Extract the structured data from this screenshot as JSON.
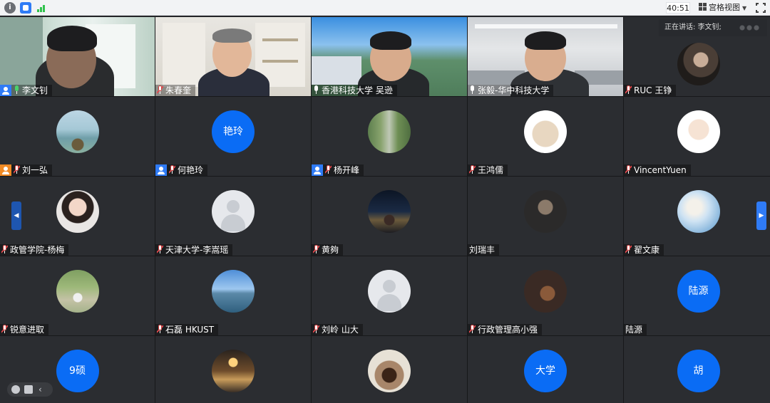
{
  "topbar": {
    "timer": "40:51",
    "layout_label": "宫格视图"
  },
  "speaking": {
    "label": "正在讲话: 李文钊;"
  },
  "tiles": [
    {
      "name": "李文钊",
      "role": "host",
      "mic": "active"
    },
    {
      "name": "朱春奎",
      "role": "none",
      "mic": "muted"
    },
    {
      "name": "香港科技大学 吴逊",
      "role": "none",
      "mic": "on"
    },
    {
      "name": "张毅-华中科技大学",
      "role": "none",
      "mic": "on"
    },
    {
      "name": "RUC 王铮",
      "role": "none",
      "mic": "muted"
    },
    {
      "name": "刘一弘",
      "role": "cohost",
      "mic": "muted"
    },
    {
      "name": "何艳玲",
      "role": "host",
      "mic": "muted",
      "avatar_text": "艳玲"
    },
    {
      "name": "杨开峰",
      "role": "host",
      "mic": "muted"
    },
    {
      "name": "王鸿儒",
      "role": "none",
      "mic": "muted"
    },
    {
      "name": "VincentYuen",
      "role": "none",
      "mic": "muted"
    },
    {
      "name": "政管学院-杨梅",
      "role": "none",
      "mic": "muted"
    },
    {
      "name": "天津大学-李嵩瑶",
      "role": "none",
      "mic": "muted"
    },
    {
      "name": "黄夠",
      "role": "none",
      "mic": "muted"
    },
    {
      "name": "刘瑞丰",
      "role": "none",
      "mic": "none"
    },
    {
      "name": "翟文康",
      "role": "none",
      "mic": "muted"
    },
    {
      "name": "锐意进取",
      "role": "none",
      "mic": "muted"
    },
    {
      "name": "石磊 HKUST",
      "role": "none",
      "mic": "muted"
    },
    {
      "name": "刘岭 山大",
      "role": "none",
      "mic": "muted"
    },
    {
      "name": "行政管理高小强",
      "role": "none",
      "mic": "muted"
    },
    {
      "name": "陆源",
      "role": "none",
      "mic": "none",
      "avatar_text": "陆源"
    },
    {
      "name": "",
      "avatar_text": "9硕"
    },
    {
      "name": ""
    },
    {
      "name": ""
    },
    {
      "name": "",
      "avatar_text": "大学"
    },
    {
      "name": "",
      "avatar_text": "胡"
    }
  ],
  "colors": {
    "accent": "#0a6cf5",
    "host_badge": "#2f7bf6",
    "cohost_badge": "#f08a24",
    "tile_bg": "#2b2d31"
  }
}
